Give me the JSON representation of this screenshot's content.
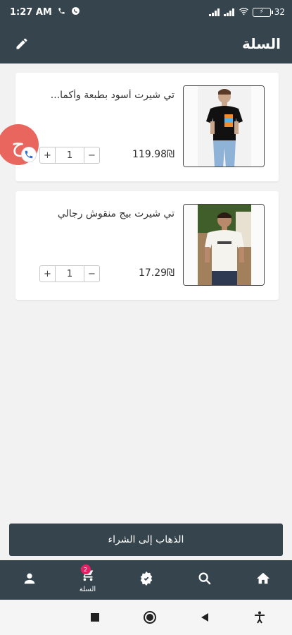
{
  "status_bar": {
    "time": "1:27 AM",
    "battery": "32"
  },
  "header": {
    "title": "السلة",
    "edit_icon": "pencil-icon"
  },
  "cart_items": [
    {
      "name": "تي شيرت أسود بطبعة وأكما...",
      "price": "119.98₪",
      "quantity": "1",
      "image": "man-in-black-tshirt"
    },
    {
      "name": "تي شيرت بيج منقوش رجالي",
      "price": "17.29₪",
      "quantity": "1",
      "image": "man-in-beige-tshirt"
    }
  ],
  "stepper": {
    "plus": "+",
    "minus": "−"
  },
  "chat_fab": {
    "letter": "ح",
    "icon": "phone-icon"
  },
  "checkout_button": "الذهاب إلى الشراء",
  "bottom_nav": {
    "items": [
      {
        "icon": "home-icon",
        "label": ""
      },
      {
        "icon": "search-icon",
        "label": ""
      },
      {
        "icon": "categories-icon",
        "label": ""
      },
      {
        "icon": "cart-icon",
        "label": "السلة",
        "badge": "2"
      },
      {
        "icon": "account-icon",
        "label": ""
      }
    ]
  },
  "colors": {
    "primary": "#36454d",
    "fab": "#e9665f",
    "badge": "#e91e63"
  }
}
